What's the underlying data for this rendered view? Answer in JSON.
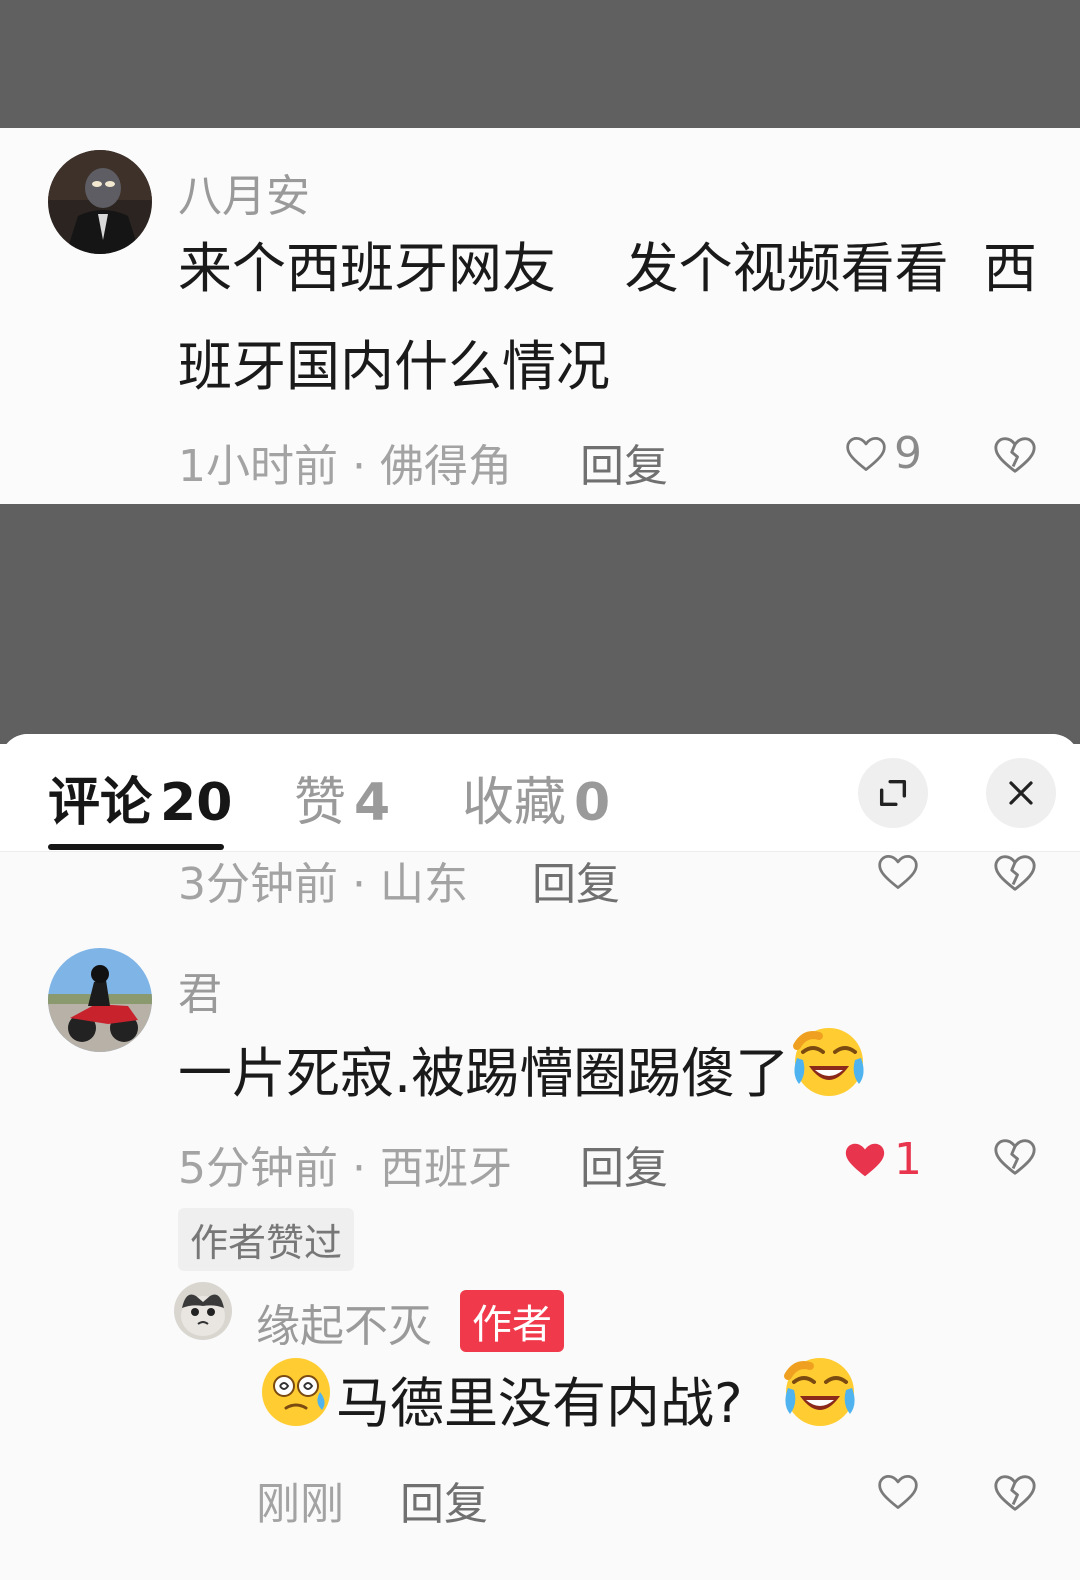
{
  "top_comment": {
    "username": "八月安",
    "text_line1": "来个西班牙网友    发个视频看看  西",
    "text_line2": "班牙国内什么情况",
    "meta": "1小时前 · 佛得角",
    "reply_label": "回复",
    "like_count": "9"
  },
  "sheet": {
    "tabs": [
      {
        "label": "评论",
        "count": "20"
      },
      {
        "label": "赞",
        "count": "4"
      },
      {
        "label": "收藏",
        "count": "0"
      }
    ],
    "partial_comment": {
      "meta": "3分钟前 · 山东",
      "reply_label": "回复"
    },
    "comment": {
      "username": "君",
      "text": "一片死寂.被踢懵圈踢傻了",
      "meta": "5分钟前 · 西班牙",
      "reply_label": "回复",
      "like_count": "1",
      "author_liked_badge": "作者赞过"
    },
    "reply": {
      "username": "缘起不灭",
      "author_tag": "作者",
      "text": "马德里没有内战?",
      "meta": "刚刚",
      "reply_label": "回复"
    }
  },
  "icons": {
    "like": "heart-outline-icon",
    "like_active": "heart-filled-icon",
    "dislike": "broken-heart-icon",
    "expand": "expand-icon",
    "close": "close-icon",
    "emoji_laugh": "laughing-crying-emoji",
    "emoji_dizzy": "dizzy-face-emoji"
  },
  "colors": {
    "like_active": "#e8344d",
    "author_tag": "#f03a4c",
    "background_dim": "#606060"
  }
}
